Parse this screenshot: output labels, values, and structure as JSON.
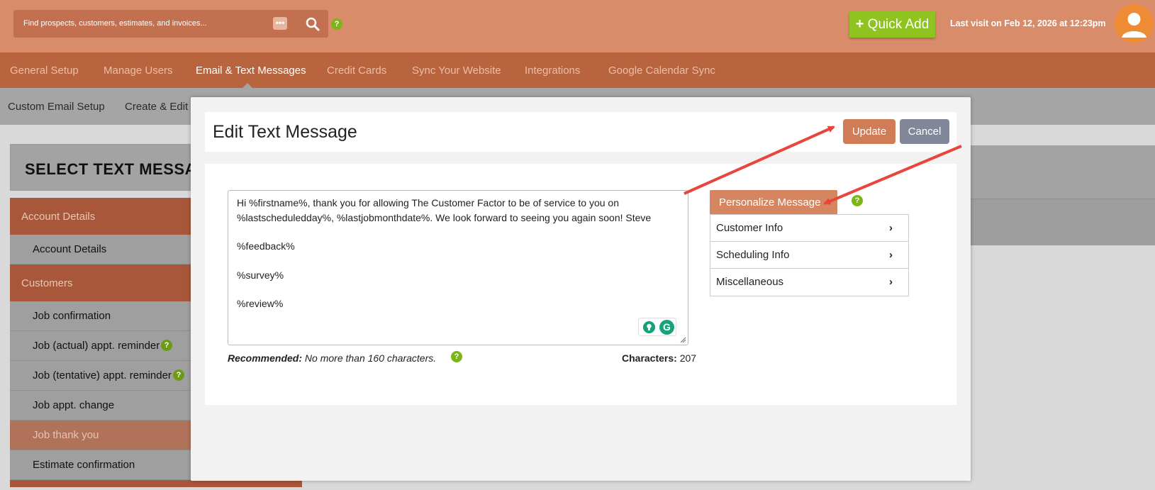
{
  "header": {
    "search_placeholder": "Find prospects, customers, estimates, and invoices...",
    "dots_label": "•••",
    "help_label": "?",
    "quick_add_plus": "+",
    "quick_add_label": "Quick Add",
    "last_visit": "Last visit on  Feb 12, 2026  at 12:23pm"
  },
  "nav": {
    "items": [
      "General Setup",
      "Manage Users",
      "Email & Text Messages",
      "Credit Cards",
      "Sync Your Website",
      "Integrations",
      "Google Calendar Sync"
    ],
    "active": "Email & Text Messages"
  },
  "subnav": {
    "items": [
      "Custom Email Setup",
      "Create & Edit E"
    ]
  },
  "left_panel": {
    "title": "SELECT TEXT MESSAG",
    "sections": [
      {
        "label": "Account Details",
        "items": [
          {
            "label": "Account Details"
          }
        ]
      },
      {
        "label": "Customers",
        "items": [
          {
            "label": "Job confirmation"
          },
          {
            "label": "Job (actual) appt. reminder",
            "help": "?"
          },
          {
            "label": "Job (tentative) appt. reminder",
            "help": "?"
          },
          {
            "label": "Job appt. change"
          },
          {
            "label": "Job thank you",
            "active": true
          },
          {
            "label": "Estimate confirmation"
          }
        ]
      }
    ]
  },
  "modal": {
    "title": "Edit Text Message",
    "update_label": "Update",
    "cancel_label": "Cancel",
    "message_lines": [
      "Hi %firstname%, thank you for allowing The Customer Factor to be of service to you on",
      "%lastscheduledday%, %lastjobmonthdate%. We look forward to seeing you again soon! Steve",
      "%feedback%",
      "%survey%",
      "%review%"
    ],
    "grammarly_letter": "G",
    "recommended_label": "Recommended:",
    "recommended_text": " No more than 160 characters.",
    "help_label": "?",
    "characters_label": "Characters:",
    "characters_value": "207",
    "personalize_label": "Personalize Message",
    "personalize_menu": [
      "Customer Info",
      "Scheduling Info",
      "Miscellaneous"
    ],
    "chevron": "›"
  },
  "colors": {
    "header": "#d98c6a",
    "nav": "#b8643f",
    "accent": "#cf7c57",
    "quick_add": "#8fc320",
    "help": "#7cb518",
    "cancel": "#818799",
    "arrow": "#e8463d"
  }
}
